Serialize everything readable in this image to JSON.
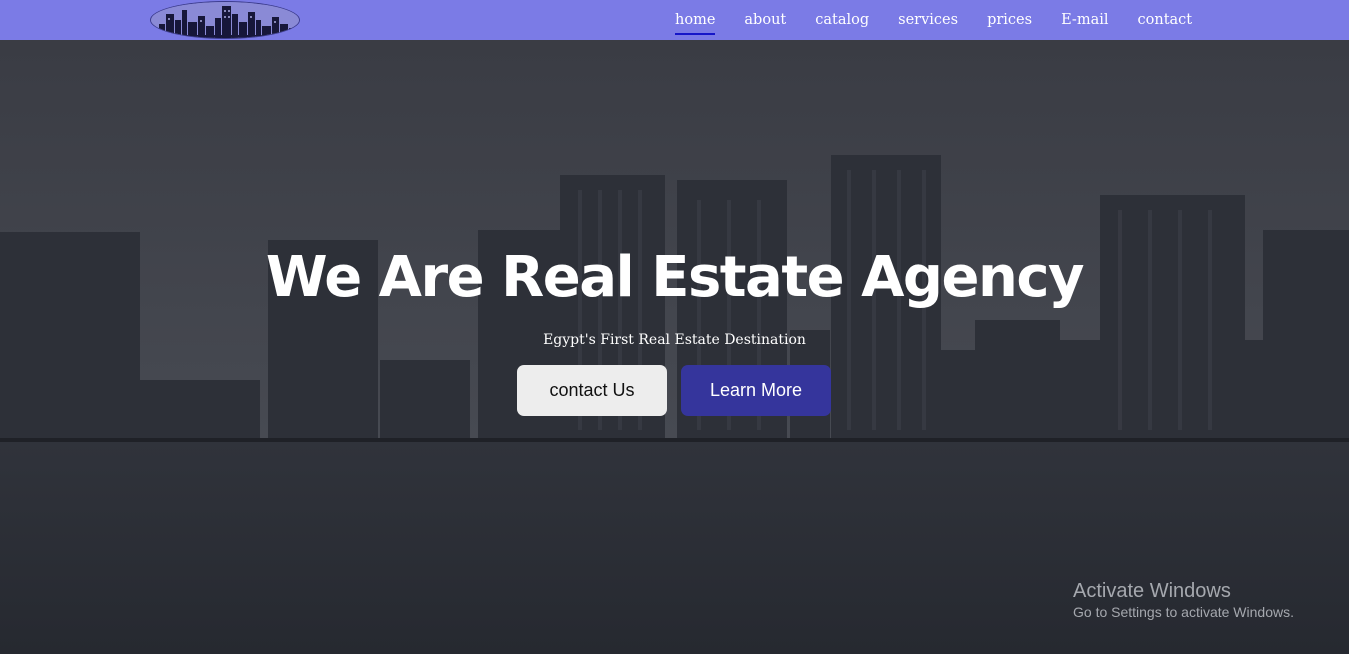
{
  "colors": {
    "navbar": "#7b7be6",
    "active_underline": "#1616c8",
    "learn_more_button": "#35359c",
    "contact_button": "#ededed"
  },
  "nav": {
    "links": [
      {
        "label": "home",
        "active": true
      },
      {
        "label": "about"
      },
      {
        "label": "catalog"
      },
      {
        "label": "services"
      },
      {
        "label": "prices"
      },
      {
        "label": "E-mail"
      },
      {
        "label": "contact"
      }
    ]
  },
  "hero": {
    "title": "We Are Real Estate Agency",
    "subtitle": "Egypt's First Real Estate Destination",
    "contact_label": "contact Us",
    "learn_label": "Learn More"
  },
  "watermark": {
    "title": "Activate Windows",
    "subtitle": "Go to Settings to activate Windows."
  }
}
